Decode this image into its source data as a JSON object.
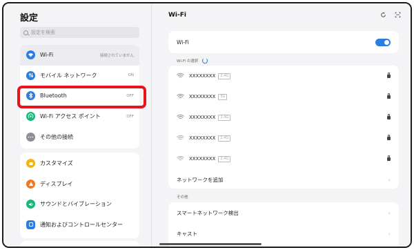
{
  "left": {
    "title": "設定",
    "search_placeholder": "設定を検索",
    "group1": [
      {
        "label": "Wi-Fi",
        "status": "接続されていません",
        "icon": "wifi-icon",
        "color": "#2a7de1"
      },
      {
        "label": "モバイル ネットワーク",
        "status": "ON",
        "icon": "mobile-network-icon",
        "color": "#2a7de1"
      },
      {
        "label": "Bluetooth",
        "status": "OFF",
        "icon": "bluetooth-icon",
        "color": "#2a7de1"
      },
      {
        "label": "Wi-Fi アクセス ポイント",
        "status": "OFF",
        "icon": "hotspot-icon",
        "color": "#18b87a"
      },
      {
        "label": "その他の接続",
        "status": "",
        "icon": "more-connections-icon",
        "color": "#8e8e9a"
      }
    ],
    "group2": [
      {
        "label": "カスタマイズ",
        "icon": "customize-icon",
        "color": "#f2b411"
      },
      {
        "label": "ディスプレイ",
        "icon": "display-icon",
        "color": "#f07a23"
      },
      {
        "label": "サウンドとバイブレーション",
        "icon": "sound-icon",
        "color": "#18b87a"
      },
      {
        "label": "通知およびコントロールセンター",
        "icon": "notification-icon",
        "color": "#2a7de1"
      }
    ]
  },
  "right": {
    "title": "Wi-Fi",
    "wifi_label": "Wi-Fi",
    "wifi_on": true,
    "select_section": "Wi-Fi の選択",
    "networks": [
      {
        "ssid": "XXXXXXXX",
        "band": "2.4G"
      },
      {
        "ssid": "XXXXXXXX",
        "band": "5G"
      },
      {
        "ssid": "XXXXXXXX",
        "band": "2.4G"
      },
      {
        "ssid": "XXXXXXXX",
        "band": "2.4G"
      },
      {
        "ssid": "XXXXXXXX",
        "band": "2.4G"
      }
    ],
    "add_network": "ネットワークを追加",
    "other_section": "その他",
    "other_items": [
      "スマートネットワーク検出",
      "キャスト"
    ]
  },
  "colors": {
    "accent": "#2a7de1",
    "highlight": "#e8141b"
  }
}
